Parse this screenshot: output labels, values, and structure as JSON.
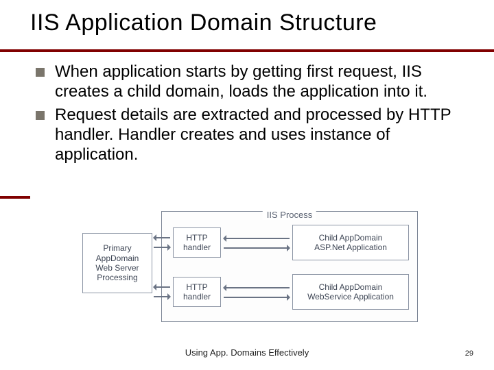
{
  "title": "IIS Application Domain Structure",
  "bullets": [
    "When application starts by getting first request, IIS creates a child domain, loads the application into it.",
    "Request details are extracted and processed by HTTP handler.  Handler creates and uses instance of application."
  ],
  "diagram": {
    "container_label": "IIS Process",
    "primary": "Primary\nAppDomain\nWeb Server\nProcessing",
    "http_handler": "HTTP\nhandler",
    "child1": "Child AppDomain\nASP.Net Application",
    "child2": "Child AppDomain\nWebService Application"
  },
  "footer": "Using App. Domains Effectively",
  "page": "29"
}
